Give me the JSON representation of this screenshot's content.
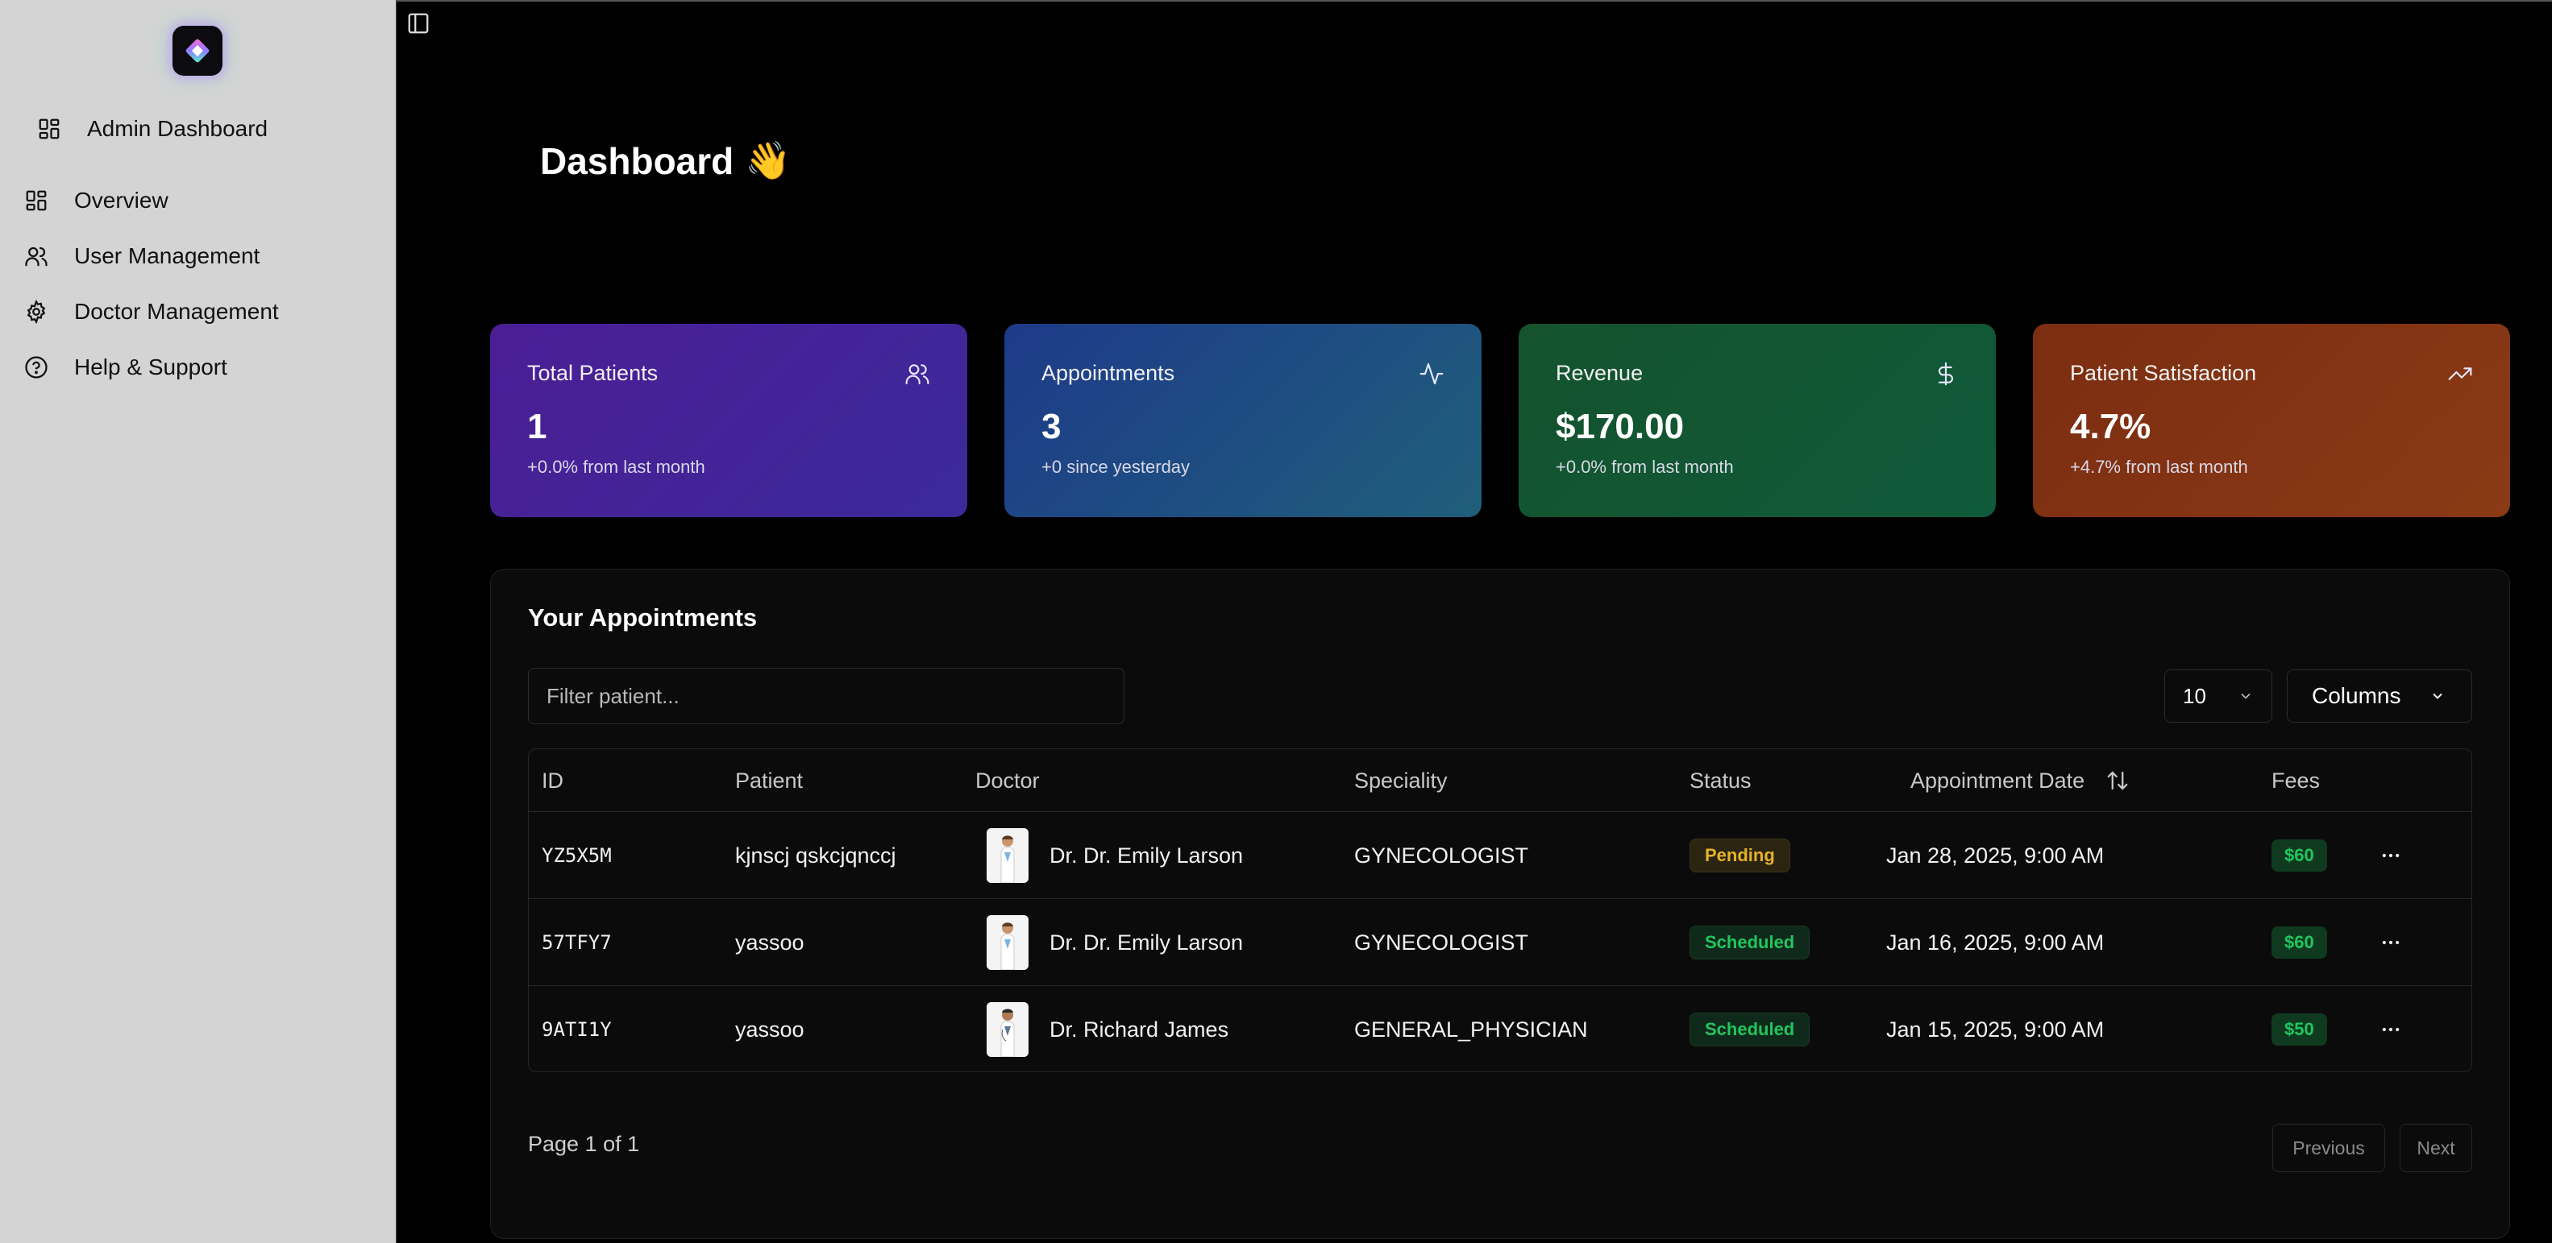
{
  "sidebar": {
    "admin_label": "Admin Dashboard",
    "items": [
      {
        "label": "Overview",
        "icon": "grid-icon"
      },
      {
        "label": "User Management",
        "icon": "users-icon"
      },
      {
        "label": "Doctor Management",
        "icon": "gear-icon"
      },
      {
        "label": "Help & Support",
        "icon": "help-circle-icon"
      }
    ]
  },
  "header": {
    "title": "Dashboard",
    "emoji": "👋"
  },
  "stats": [
    {
      "title": "Total Patients",
      "value": "1",
      "sub": "+0.0% from last month",
      "icon": "users-icon",
      "color_from": "#4c1d95",
      "color_to": "#3b2a9a"
    },
    {
      "title": "Appointments",
      "value": "3",
      "sub": "+0 since yesterday",
      "icon": "activity-icon",
      "color_from": "#1e3a8a",
      "color_to": "#1f5f7a"
    },
    {
      "title": "Revenue",
      "value": "$170.00",
      "sub": "+0.0% from last month",
      "icon": "dollar-icon",
      "color_from": "#14532d",
      "color_to": "#0f5a3a"
    },
    {
      "title": "Patient Satisfaction",
      "value": "4.7%",
      "sub": "+4.7% from last month",
      "icon": "trending-up-icon",
      "color_from": "#7c2d12",
      "color_to": "#8a3a14"
    }
  ],
  "appointments": {
    "title": "Your Appointments",
    "filter_placeholder": "Filter patient...",
    "page_size": "10",
    "columns_label": "Columns",
    "headers": {
      "id": "ID",
      "patient": "Patient",
      "doctor": "Doctor",
      "speciality": "Speciality",
      "status": "Status",
      "date": "Appointment Date",
      "fees": "Fees"
    },
    "rows": [
      {
        "id": "YZ5X5M",
        "patient": "kjnscj qskcjqnccj",
        "doctor": "Dr. Dr. Emily Larson",
        "speciality": "GYNECOLOGIST",
        "status": "Pending",
        "date": "Jan 28, 2025, 9:00 AM",
        "fee": "$60"
      },
      {
        "id": "57TFY7",
        "patient": "yassoo",
        "doctor": "Dr. Dr. Emily Larson",
        "speciality": "GYNECOLOGIST",
        "status": "Scheduled",
        "date": "Jan 16, 2025, 9:00 AM",
        "fee": "$60"
      },
      {
        "id": "9ATI1Y",
        "patient": "yassoo",
        "doctor": "Dr. Richard James",
        "speciality": "GENERAL_PHYSICIAN",
        "status": "Scheduled",
        "date": "Jan 15, 2025, 9:00 AM",
        "fee": "$50"
      }
    ],
    "page_info": "Page 1 of 1",
    "previous_label": "Previous",
    "next_label": "Next"
  }
}
